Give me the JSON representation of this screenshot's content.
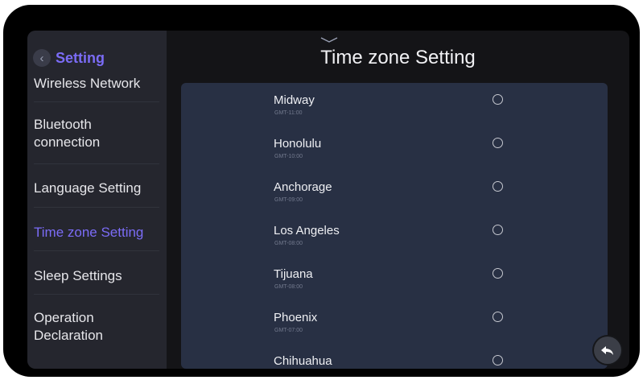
{
  "sidebar": {
    "back_glyph": "‹",
    "title": "Setting",
    "items": [
      {
        "label": "Wireless Network",
        "active": false
      },
      {
        "label": "Bluetooth connection",
        "active": false
      },
      {
        "label": "Language Setting",
        "active": false
      },
      {
        "label": "Time zone Setting",
        "active": true
      },
      {
        "label": "Sleep Settings",
        "active": false
      },
      {
        "label": "Operation Declaration",
        "active": false
      }
    ]
  },
  "main": {
    "title": "Time zone Setting",
    "timezones": [
      {
        "city": "Midway",
        "gmt": "GMT-11:00",
        "selected": false
      },
      {
        "city": "Honolulu",
        "gmt": "GMT-10:00",
        "selected": false
      },
      {
        "city": "Anchorage",
        "gmt": "GMT-09:00",
        "selected": false
      },
      {
        "city": "Los Angeles",
        "gmt": "GMT-08:00",
        "selected": false
      },
      {
        "city": "Tijuana",
        "gmt": "GMT-08:00",
        "selected": false
      },
      {
        "city": "Phoenix",
        "gmt": "GMT-07:00",
        "selected": false
      },
      {
        "city": "Chihuahua",
        "gmt": "",
        "selected": false
      }
    ]
  },
  "icons": {
    "back": "chevron-left-icon",
    "pulldown": "chevron-down-icon",
    "return": "return-arrow-icon"
  },
  "colors": {
    "accent": "#7b6cf6",
    "sidebar_bg": "#25262e",
    "panel_bg": "#283044",
    "screen_bg": "#141417"
  }
}
